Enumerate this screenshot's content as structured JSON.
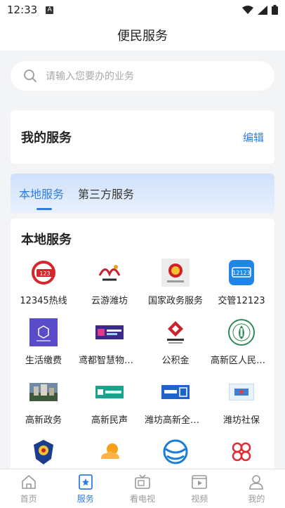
{
  "status": {
    "time": "12:33",
    "a_badge": "A"
  },
  "page": {
    "title": "便民服务"
  },
  "search": {
    "placeholder": "请输入您要办的业务"
  },
  "my_services": {
    "label": "我的服务",
    "edit_label": "编辑"
  },
  "tabs": [
    {
      "label": "本地服务",
      "active": true
    },
    {
      "label": "第三方服务",
      "active": false
    }
  ],
  "local": {
    "heading": "本地服务",
    "items": [
      {
        "label": "12345热线",
        "icon": "hotline-12345-icon"
      },
      {
        "label": "云游潍坊",
        "icon": "yunyou-weifang-icon"
      },
      {
        "label": "国家政务服务",
        "icon": "national-emblem-icon"
      },
      {
        "label": "交管12123",
        "icon": "traffic-12123-icon"
      },
      {
        "label": "生活缴费",
        "icon": "life-payment-icon"
      },
      {
        "label": "鸢都智慧物业...",
        "icon": "smart-property-icon"
      },
      {
        "label": "公积金",
        "icon": "housing-fund-icon"
      },
      {
        "label": "高新区人民医...",
        "icon": "hospital-icon"
      },
      {
        "label": "高新政务",
        "icon": "gov-affairs-icon"
      },
      {
        "label": "高新民声",
        "icon": "minsheng-icon"
      },
      {
        "label": "潍坊高新全程...",
        "icon": "fullprocess-icon"
      },
      {
        "label": "潍坊社保",
        "icon": "social-security-icon"
      },
      {
        "label": "",
        "icon": "police-badge-icon"
      },
      {
        "label": "",
        "icon": "weather-icon"
      },
      {
        "label": "",
        "icon": "china-mobile-icon"
      },
      {
        "label": "",
        "icon": "china-unicom-icon"
      }
    ]
  },
  "nav": [
    {
      "label": "首页",
      "icon": "home-icon",
      "active": false
    },
    {
      "label": "服务",
      "icon": "service-icon",
      "active": true
    },
    {
      "label": "看电视",
      "icon": "tv-icon",
      "active": false
    },
    {
      "label": "视频",
      "icon": "video-icon",
      "active": false
    },
    {
      "label": "我的",
      "icon": "profile-icon",
      "active": false
    }
  ],
  "colors": {
    "accent": "#2f7de1",
    "background": "#f3f4f6"
  }
}
